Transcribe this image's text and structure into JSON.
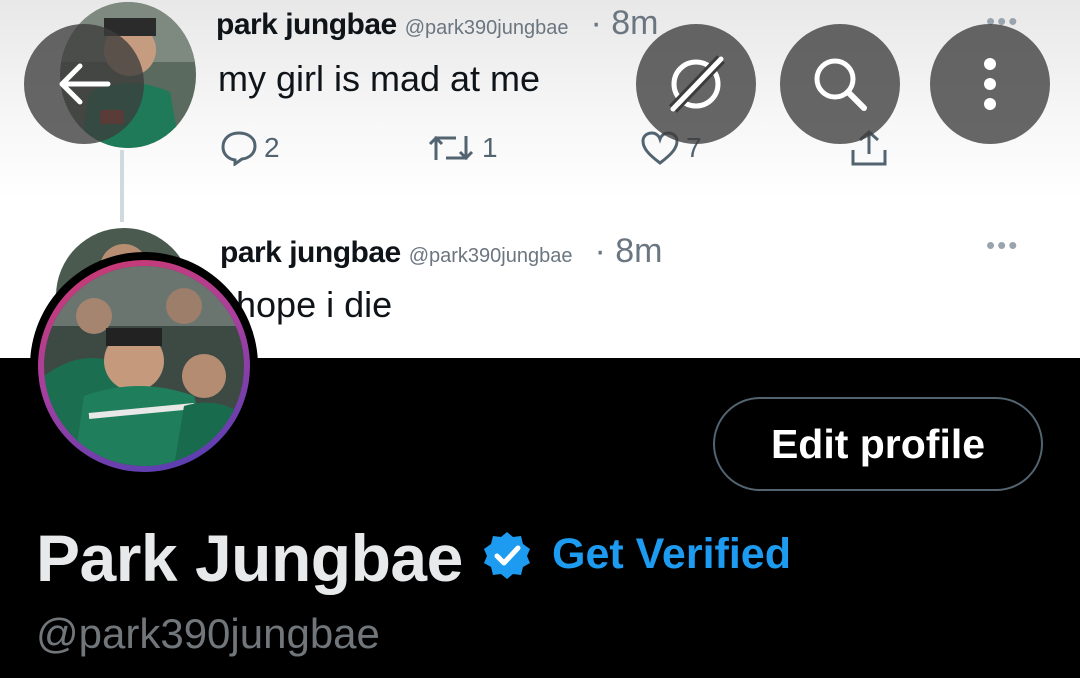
{
  "banner": {
    "tweets": [
      {
        "name": "park jungbae",
        "handle": "@park390jungbae",
        "time": "8m",
        "text": "my girl is mad at me",
        "replies": "2",
        "retweets": "1",
        "likes": "7",
        "more": "•••"
      },
      {
        "name": "park jungbae",
        "handle": "@park390jungbae",
        "time": "8m",
        "text": "hope i die",
        "more": "•••"
      }
    ]
  },
  "header_buttons": {
    "back": "back-arrow-icon",
    "grok": "grok-slash-icon",
    "search": "search-icon",
    "more": "more-vertical-icon"
  },
  "profile": {
    "edit_button_label": "Edit profile",
    "display_name": "Park Jungbae",
    "get_verified_label": "Get Verified",
    "username": "@park390jungbae",
    "verified_icon": "verified-badge-icon"
  },
  "colors": {
    "background": "#000000",
    "accent": "#1d9bf0",
    "secondary_text": "#71767b",
    "primary_text": "#e7e9ea"
  }
}
